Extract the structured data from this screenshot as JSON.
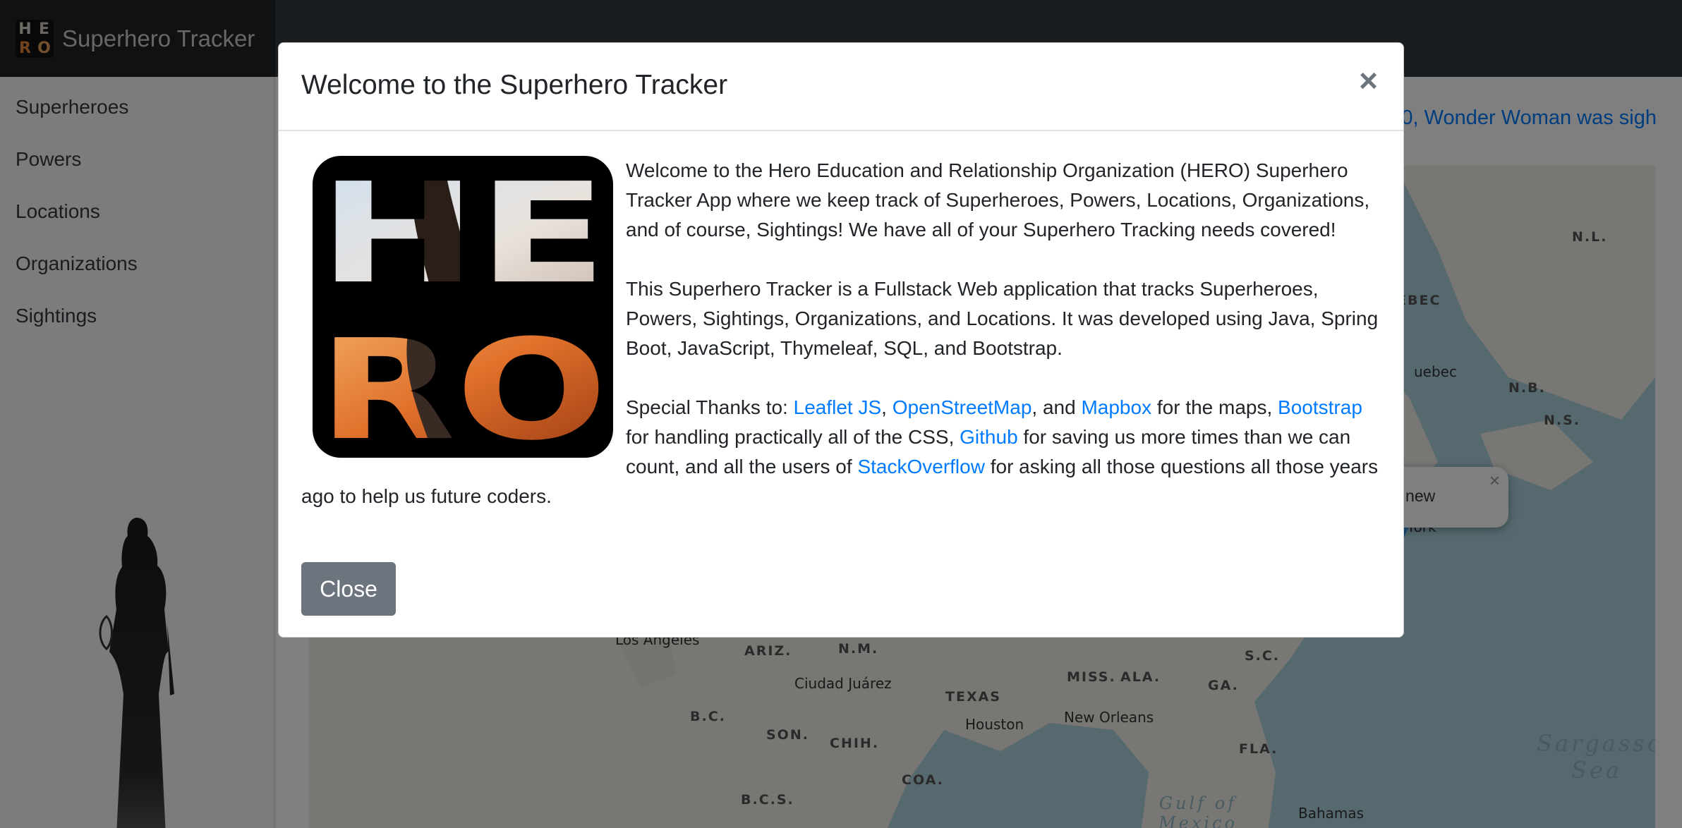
{
  "navbar": {
    "brand": "Superhero Tracker",
    "logo_letters": [
      "H",
      "E",
      "R",
      "O"
    ]
  },
  "sidebar": {
    "items": [
      {
        "label": "Superheroes"
      },
      {
        "label": "Powers"
      },
      {
        "label": "Locations"
      },
      {
        "label": "Organizations"
      },
      {
        "label": "Sightings"
      }
    ]
  },
  "main": {
    "ticker": "0, Wonder Woman was sigh",
    "map": {
      "region_labels": [
        "N.L.",
        "EBEC",
        "N.B.",
        "N.S.",
        "ARIZ.",
        "N.M.",
        "TEXAS",
        "MISS.",
        "ALA.",
        "GA.",
        "S.C.",
        "FLA.",
        "B.C.",
        "SON.",
        "CHIH.",
        "COA.",
        "B.C.S."
      ],
      "cities": [
        "uebec",
        "York",
        "Los Angeles",
        "Ciudad Juárez",
        "Houston",
        "New Orleans",
        "Bahamas"
      ],
      "seas": [
        "Sargasso Sea",
        "Gulf of Mexico"
      ],
      "popup_text": "- new",
      "popup_close": "×"
    }
  },
  "modal": {
    "title": "Welcome to the Superhero Tracker",
    "close_symbol": "×",
    "image_letters": [
      "H",
      "E",
      "R",
      "O"
    ],
    "para1": "Welcome to the Hero Education and Relationship Organization (HERO) Superhero Tracker App where we keep track of Superheroes, Powers, Locations, Organizations, and of course, Sightings! We have all of your Superhero Tracking needs covered!",
    "para2": "This Superhero Tracker is a Fullstack Web application that tracks Superheroes, Powers, Sightings, Organizations, and Locations. It was developed using Java, Spring Boot, JavaScript, Thymeleaf, SQL, and Bootstrap.",
    "thanks": {
      "t1": "Special Thanks to: ",
      "leaflet": "Leaflet JS",
      "t2": ", ",
      "osm": "OpenStreetMap",
      "t3": ", and ",
      "mapbox": "Mapbox",
      "t4": " for the maps, ",
      "bootstrap": "Bootstrap",
      "t5": " for handling practically all of the CSS, ",
      "github": "Github",
      "t6": " for saving us more times than we can count, and all the users of ",
      "stackoverflow": "StackOverflow",
      "t7": " for asking all those questions all those years ago to help us future coders."
    },
    "close_button": "Close"
  },
  "colors": {
    "link": "#007bff",
    "navbar": "#343a40",
    "button": "#6c757d",
    "water": "#aad3df",
    "land": "#f2efe9"
  }
}
